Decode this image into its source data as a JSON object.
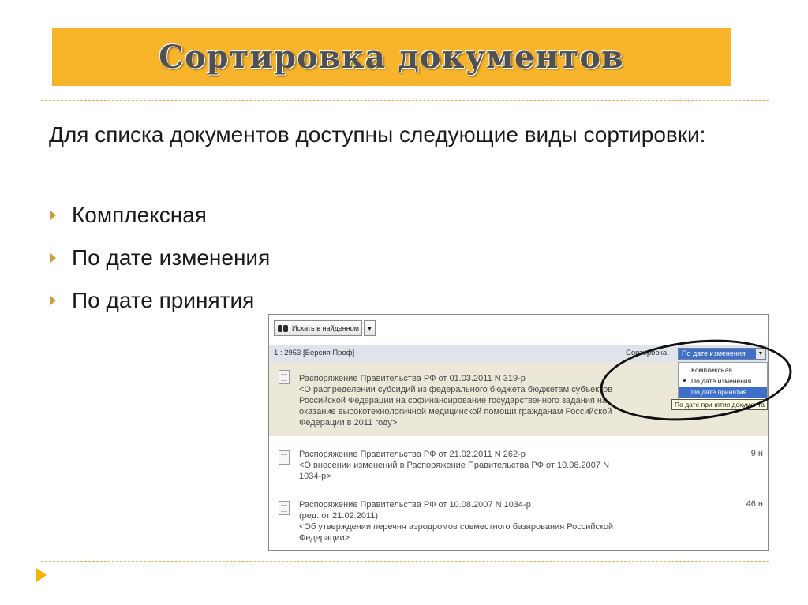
{
  "slide": {
    "title": "Сортировка документов",
    "intro": "Для списка документов доступны следующие виды сортировки:",
    "bullets": [
      "Комплексная",
      "По дате изменения",
      "По дате принятия"
    ]
  },
  "screenshot": {
    "toolbar": {
      "search_label": "Искать в найденном"
    },
    "status": "1 : 2953 [Версия Проф]",
    "sort_label": "Сортировка:",
    "sort_selected": "По дате изменения",
    "sort_options": [
      "Комплексная",
      "По дате изменения",
      "По дате принятия"
    ],
    "tooltip": "По дате принятия документа",
    "documents": [
      {
        "lines": [
          "Распоряжение Правительства РФ от 01.03.2011 N 319-р",
          "<О распределении субсидий из федерального бюджета бюджетам субъектов",
          "Российской Федерации на софинансирование государственного задания на",
          "оказание высокотехнологичной медицинской помощи гражданам Российской",
          "Федерации в 2011 году>"
        ],
        "num": ""
      },
      {
        "lines": [
          "Распоряжение Правительства РФ от 21.02.2011 N 262-р",
          "<О внесении изменений в Распоряжение Правительства РФ от 10.08.2007 N",
          "1034-р>"
        ],
        "num": "9 н"
      },
      {
        "lines": [
          "Распоряжение Правительства РФ от 10.08.2007 N 1034-р",
          "(ред. от 21.02.2011)",
          "<Об утверждении перечня аэродромов совместного базирования Российской",
          "Федерации>"
        ],
        "num": "46 н"
      }
    ]
  }
}
